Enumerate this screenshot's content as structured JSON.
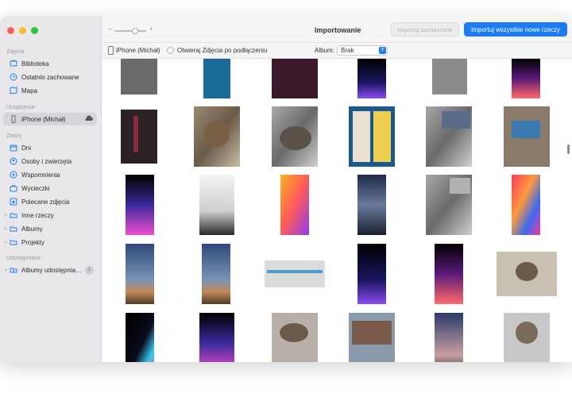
{
  "sidebar": {
    "sections": {
      "photos": "Zdjęcia",
      "devices": "Urządzenia",
      "collections": "Zbiory",
      "sharing": "Udostępniane"
    },
    "items": {
      "library": "Biblioteka",
      "recently_saved": "Ostatnio zachowane",
      "map": "Mapa",
      "iphone": "iPhone (Michał)",
      "days": "Dni",
      "people_pets": "Osoby i zwierzęta",
      "memories": "Wspomnienia",
      "trips": "Wycieczki",
      "featured": "Polecane zdjęcia",
      "other": "Inne rzeczy",
      "albums": "Albumy",
      "projects": "Projekty",
      "shared_albums": "Albumy udostępnia…",
      "shared_badge": "1"
    }
  },
  "toolbar": {
    "title": "Importowanie",
    "import_selected": "Importuj zaznaczone",
    "import_all": "Importuj wszystkie nowe rzeczy",
    "zoom_minus": "−",
    "zoom_plus": "+",
    "zoom_level": 0.8
  },
  "subbar": {
    "device": "iPhone (Michał)",
    "open_on_connect": "Otwieraj Zdjęcia po podłączeniu",
    "album_label": "Album:",
    "album_value": "Brak"
  },
  "colors": {
    "accent": "#1d7cf2",
    "sidebar_bg": "#e9e7ea"
  }
}
